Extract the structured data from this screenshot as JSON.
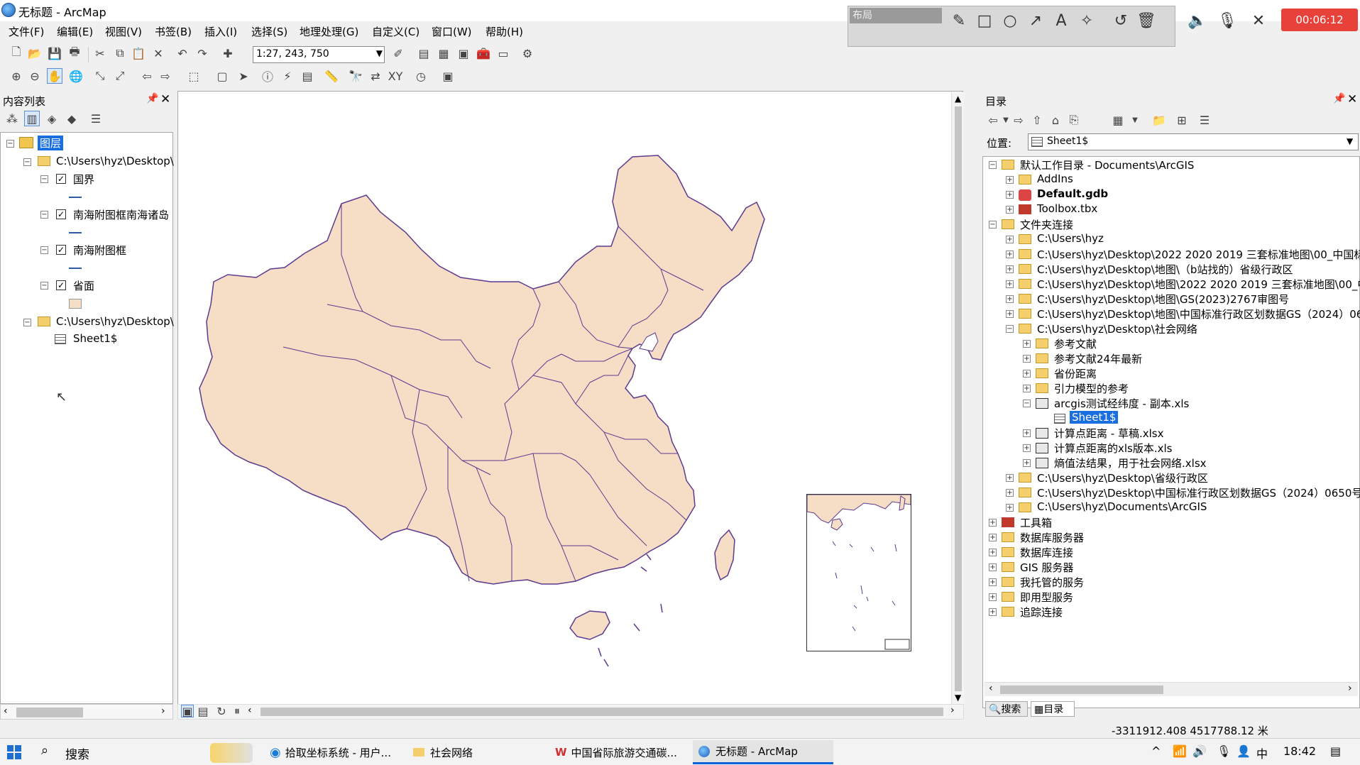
{
  "window": {
    "title": "无标题 - ArcMap"
  },
  "recorder": {
    "layout_label": "布局",
    "timer": "00:06:12"
  },
  "menu": [
    "文件(F)",
    "编辑(E)",
    "视图(V)",
    "书签(B)",
    "插入(I)",
    "选择(S)",
    "地理处理(G)",
    "自定义(C)",
    "窗口(W)",
    "帮助(H)"
  ],
  "toolbar": {
    "scale_value": "1:27, 243, 750"
  },
  "toc": {
    "header": "内容列表",
    "root": "图层",
    "group1_path": "C:\\Users\\hyz\\Desktop\\",
    "layers": [
      "国界",
      "南海附图框南海诸岛",
      "南海附图框",
      "省面"
    ],
    "group2_path": "C:\\Users\\hyz\\Desktop\\",
    "table": "Sheet1$"
  },
  "catalog": {
    "header": "目录",
    "location_label": "位置:",
    "location_value": "Sheet1$",
    "rows": [
      "默认工作目录 - Documents\\ArcGIS",
      "AddIns",
      "Default.gdb",
      "Toolbox.tbx",
      "文件夹连接",
      "C:\\Users\\hyz",
      "C:\\Users\\hyz\\Desktop\\2022 2020 2019 三套标准地图\\00_中国标",
      "C:\\Users\\hyz\\Desktop\\地图\\（b站找的）省级行政区",
      "C:\\Users\\hyz\\Desktop\\地图\\2022 2020 2019 三套标准地图\\00_中",
      "C:\\Users\\hyz\\Desktop\\地图\\GS(2023)2767审图号",
      "C:\\Users\\hyz\\Desktop\\地图\\中国标准行政区划数据GS（2024）06",
      "C:\\Users\\hyz\\Desktop\\社会网络",
      "参考文献",
      "参考文献24年最新",
      "省份距离",
      "引力模型的参考",
      "arcgis测试经纬度 - 副本.xls",
      "Sheet1$",
      "计算点距离 - 草稿.xlsx",
      "计算点距离的xls版本.xls",
      "熵值法结果，用于社会网络.xlsx",
      "C:\\Users\\hyz\\Desktop\\省级行政区",
      "C:\\Users\\hyz\\Desktop\\中国标准行政区划数据GS（2024）0650号",
      "C:\\Users\\hyz\\Documents\\ArcGIS",
      "工具箱",
      "数据库服务器",
      "数据库连接",
      "GIS 服务器",
      "我托管的服务",
      "即用型服务",
      "追踪连接"
    ],
    "tabs": [
      "搜索",
      "目录"
    ]
  },
  "status": {
    "coords": "-3311912.408  4517788.12 米"
  },
  "taskbar": {
    "search": "搜索",
    "apps": [
      "拾取坐标系统 - 用户...",
      "社会网络",
      "中国省际旅游交通碳...",
      "无标题 - ArcMap"
    ],
    "ime": "中",
    "time": "18:42"
  },
  "colors": {
    "province_fill": "#f6ddc6",
    "boundary": "#5b3a8f",
    "selection": "#1a6fe0"
  }
}
